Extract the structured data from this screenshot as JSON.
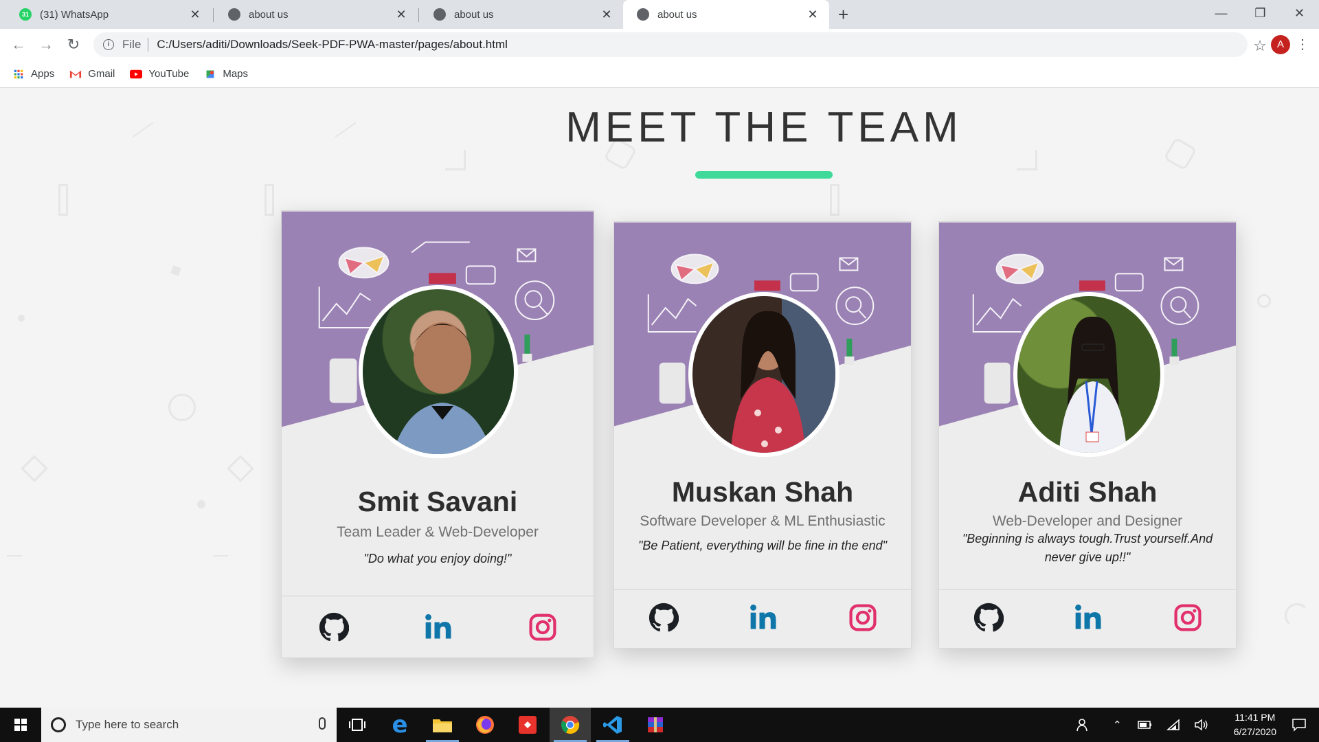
{
  "browser": {
    "tabs": [
      {
        "title": "(31) WhatsApp",
        "favicon": "whatsapp-icon",
        "badge": "31",
        "active": false
      },
      {
        "title": "about us",
        "favicon": "globe-icon",
        "active": false
      },
      {
        "title": "about us",
        "favicon": "globe-icon",
        "active": false
      },
      {
        "title": "about us",
        "favicon": "globe-icon",
        "active": true
      }
    ],
    "address": {
      "scheme": "File",
      "url": "C:/Users/aditi/Downloads/Seek-PDF-PWA-master/pages/about.html"
    },
    "profile_initial": "A",
    "bookmarks": [
      {
        "label": "Apps",
        "icon": "apps-grid-icon"
      },
      {
        "label": "Gmail",
        "icon": "gmail-icon"
      },
      {
        "label": "YouTube",
        "icon": "youtube-icon"
      },
      {
        "label": "Maps",
        "icon": "maps-icon"
      }
    ]
  },
  "page": {
    "heading": "MEET THE TEAM",
    "accent_color": "#3fd99a",
    "banner_color": "#9b82b4",
    "members": [
      {
        "name": "Smit Savani",
        "role": "Team Leader & Web-Developer",
        "quote": "\"Do what you enjoy doing!\"",
        "links": [
          "github-icon",
          "linkedin-icon",
          "instagram-icon"
        ]
      },
      {
        "name": "Muskan Shah",
        "role": "Software Developer & ML Enthusiastic",
        "quote": "\"Be Patient, everything will be fine in the end\"",
        "links": [
          "github-icon",
          "linkedin-icon",
          "instagram-icon"
        ]
      },
      {
        "name": "Aditi Shah",
        "role": "Web-Developer and Designer",
        "quote": "\"Beginning is always tough.Trust yourself.And never give up!!\"",
        "links": [
          "github-icon",
          "linkedin-icon",
          "instagram-icon"
        ]
      }
    ]
  },
  "taskbar": {
    "search_placeholder": "Type here to search",
    "apps": [
      "task-view-icon",
      "edge-icon",
      "file-explorer-icon",
      "firefox-icon",
      "git-app-icon",
      "chrome-icon",
      "vscode-icon",
      "winrar-icon"
    ],
    "time": "11:41 PM",
    "date": "6/27/2020"
  }
}
